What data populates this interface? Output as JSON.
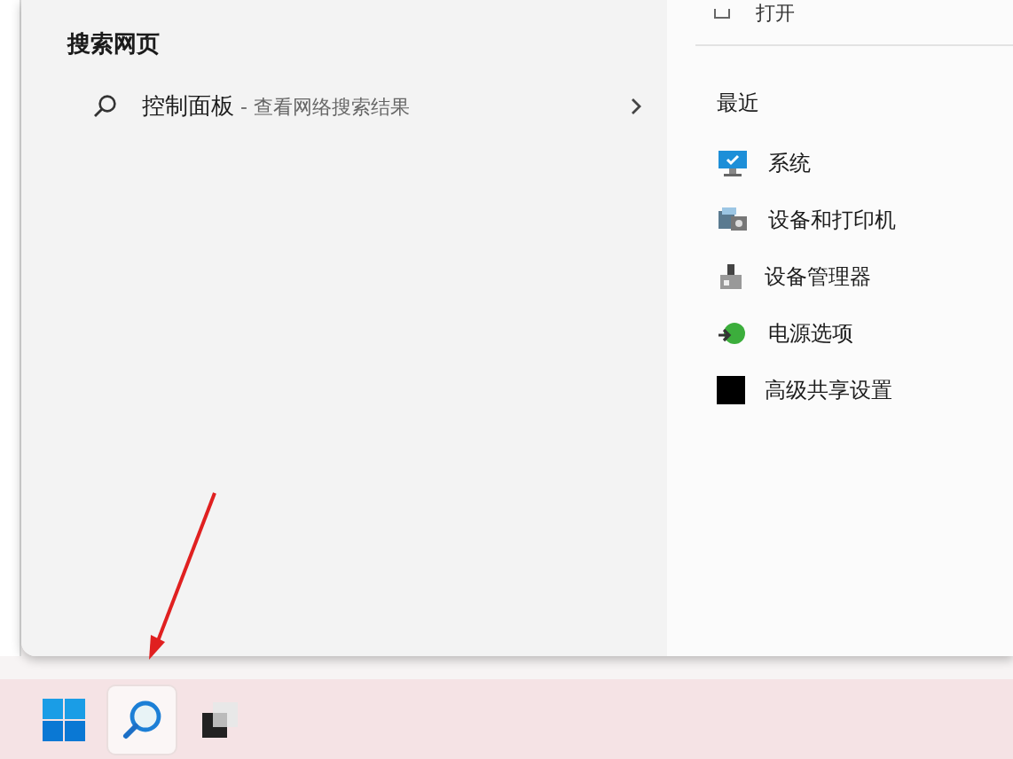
{
  "search_web": {
    "heading": "搜索网页",
    "result": {
      "query": "控制面板",
      "hint": " - 查看网络搜索结果"
    }
  },
  "right_panel": {
    "open_action": "打开",
    "recent_heading": "最近",
    "recent": [
      {
        "label": "系统",
        "kind": "system"
      },
      {
        "label": "设备和打印机",
        "kind": "printer"
      },
      {
        "label": "设备管理器",
        "kind": "devices"
      },
      {
        "label": "电源选项",
        "kind": "power"
      },
      {
        "label": "高级共享设置",
        "kind": "sharing"
      }
    ]
  },
  "taskbar": {
    "items": [
      {
        "kind": "start",
        "selected": false
      },
      {
        "kind": "search",
        "selected": true
      },
      {
        "kind": "taskview",
        "selected": false
      }
    ]
  }
}
